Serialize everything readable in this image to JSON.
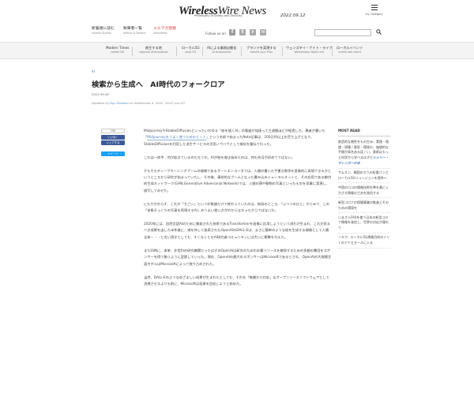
{
  "header": {
    "logo_part1": "Wireless",
    "logo_part2": "Wire News",
    "tagline": "Philosophy of Safety and Security",
    "issue_date": "2022.09.12",
    "menu_label": "by Category"
  },
  "subnav": [
    {
      "jp": "新着順に読む",
      "en": "newest Stories"
    },
    {
      "jp": "執筆者一覧",
      "en": "editors & Writers"
    },
    {
      "jp": "メルマガ登録",
      "en": "newsletter"
    }
  ],
  "follow_label": "Follow us on",
  "social_icons": [
    "facebook-icon",
    "twitter-icon",
    "rss-icon",
    "mail-icon"
  ],
  "categories": [
    {
      "jp": "Modern Times",
      "en": "realise DX"
    },
    {
      "jp": "創生する地",
      "en": "regional revitalization"
    },
    {
      "jp": "ローカル5G",
      "en": "local 5G"
    },
    {
      "jp": "AIによる業務自動化",
      "en": "AI Automation"
    },
    {
      "jp": "ブランドを実現する",
      "en": "rebuild your Plan"
    },
    {
      "jp": "ウェンズデイ・ナイト・ライブ",
      "en": "Wednesday Night Live"
    },
    {
      "jp": "ローカルイベント",
      "en": "online talk event"
    }
  ],
  "article": {
    "category": "AI",
    "title": "検索から生成へ　AI時代のフォークロア",
    "date": "2022.09.08",
    "updated_prefix": "Updated by",
    "author": "Ryo Shimizu",
    "updated_suffix": "on September 8, 2022, 20:07 pm JST",
    "paragraphs": [
      {
        "pre": "MidjourneyやStableDiffusionといったいわゆる「絵を描くAI」の隆盛が加速って三週間ほどが経過した。筆者が書いた「",
        "link": "Midjourneyをうまく使うためのヒント",
        "post": "」という名前で始まったNote記事は、100万円以上の売り上げとなり、StableDiffusionを利用した派生サービスの活用ノウハウとして歳化を重ねて行った。"
      },
      {
        "pre": "これは一体今、何が起きているのだろうか。AIが絵を描き始めたのは、何も先月が初めてではない。",
        "link": "",
        "post": ""
      },
      {
        "pre": "そもそもディープラーニングブームの端緒であるオートエンコーダでは、人間の書いた手書き数字を直像的に再現できるかというところから研究が始まっていたし、その後、事前的なブームとなった畳み込みニューラルネットと、その応用である敵対的生成ネットワーク(GAN;Generative Adversarial Network)では、人間の顔や動物の写真といったものを見事に実現し、描写してみせた。",
        "link": "",
        "post": ""
      },
      {
        "pre": "にもかかわらず、これが「すごい」という印象論だけで終わっていたのは、結局のところ、「ふつうのひと」からみて、この「本格そっくりの写真を再現するAI」のうまい使い方がわからなかったからではないか。",
        "link": "",
        "post": ""
      },
      {
        "pre": "2020年には、自然言語AIのために開発された技術であるTransformerを画像に応用しようという流れが生まれ、これが恐るべき成果を出した半年後に、満を持して発表されたOpenAIのDALL-Eは、まさに簡単のような絵を生成する端緒として人類全体・・・と言い過ぎとしても、すくなくともAI研究者コミュニティには大いに衝撃を与えた。",
        "link": "",
        "post": ""
      },
      {
        "pre": "また同時に、本来、非営利の研究機関だったはずのOpenAIは研究のための計算リソースを確保するための多額の費用をスポンサーを得て賄うように変節していった。現在、OpenAIの最大のスポンサーはMicrosoftであるとされ、OpenAIの大規模言語モデルはMicrosoftによって独り占めされた。",
        "link": "",
        "post": ""
      },
      {
        "pre": "当然、DALL-Eのようなめざましい成果が生まれたとしても、それを「無償か小口金」なオープンソースソフトウェアとして流通させるよりも前に、Microsoftは投資を回収しようと始めた。",
        "link": "",
        "post": ""
      }
    ]
  },
  "share": {
    "count": "190",
    "like_label": "いいね！",
    "share_label": "シェアする",
    "tweet_label": "ツイート"
  },
  "sidebar": {
    "title": "MOST READ",
    "items": [
      {
        "pre": "創造的な感性をもの生み、実践・理論・現場 / 意思・環境の、価値的な手間が高名ある話 / い、意欲はもっと科学から学べるはずだ",
        "strong": "シェリー・ディンガーのあ",
        "post": ""
      },
      {
        "pre": "サムスン、韓国のカウの紀電パンとローカル5Gリュージョンを提供へ",
        "strong": "",
        "post": ""
      },
      {
        "pre": "中国のロコの情報技術を準を基に入力させ情報の工夫を発信する",
        "strong": "",
        "post": ""
      },
      {
        "pre": "新型コロナの保健事業の推進とそのための環境を",
        "strong": "",
        "post": ""
      },
      {
        "pre": "いまさらFAXを使う日本の新型コロナ情報を発信し、世界の対応が遅れて",
        "strong": "",
        "post": ""
      },
      {
        "pre": "ノキア、ローカル5G規格目的のイントのアドヒオールに入る",
        "strong": "",
        "post": ""
      }
    ]
  },
  "search": {
    "placeholder": ""
  },
  "colors": {
    "link": "#4a7fbf",
    "facebook": "#3b5998",
    "twitter": "#1da1f2",
    "red": "#d33"
  }
}
